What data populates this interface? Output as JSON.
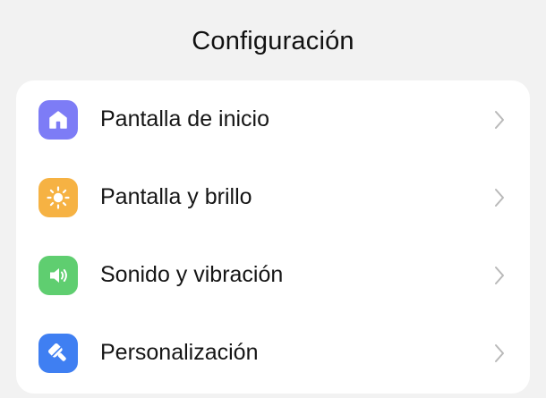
{
  "header": {
    "title": "Configuración"
  },
  "settings": {
    "items": [
      {
        "label": "Pantalla de inicio",
        "icon": "home-icon",
        "color": "#7d7cf6"
      },
      {
        "label": "Pantalla y brillo",
        "icon": "brightness-icon",
        "color": "#f6b243"
      },
      {
        "label": "Sonido y vibración",
        "icon": "speaker-icon",
        "color": "#5fce70"
      },
      {
        "label": "Personalización",
        "icon": "paintbrush-icon",
        "color": "#3f7ff2"
      }
    ],
    "chevron_color": "#b9b9b9"
  }
}
